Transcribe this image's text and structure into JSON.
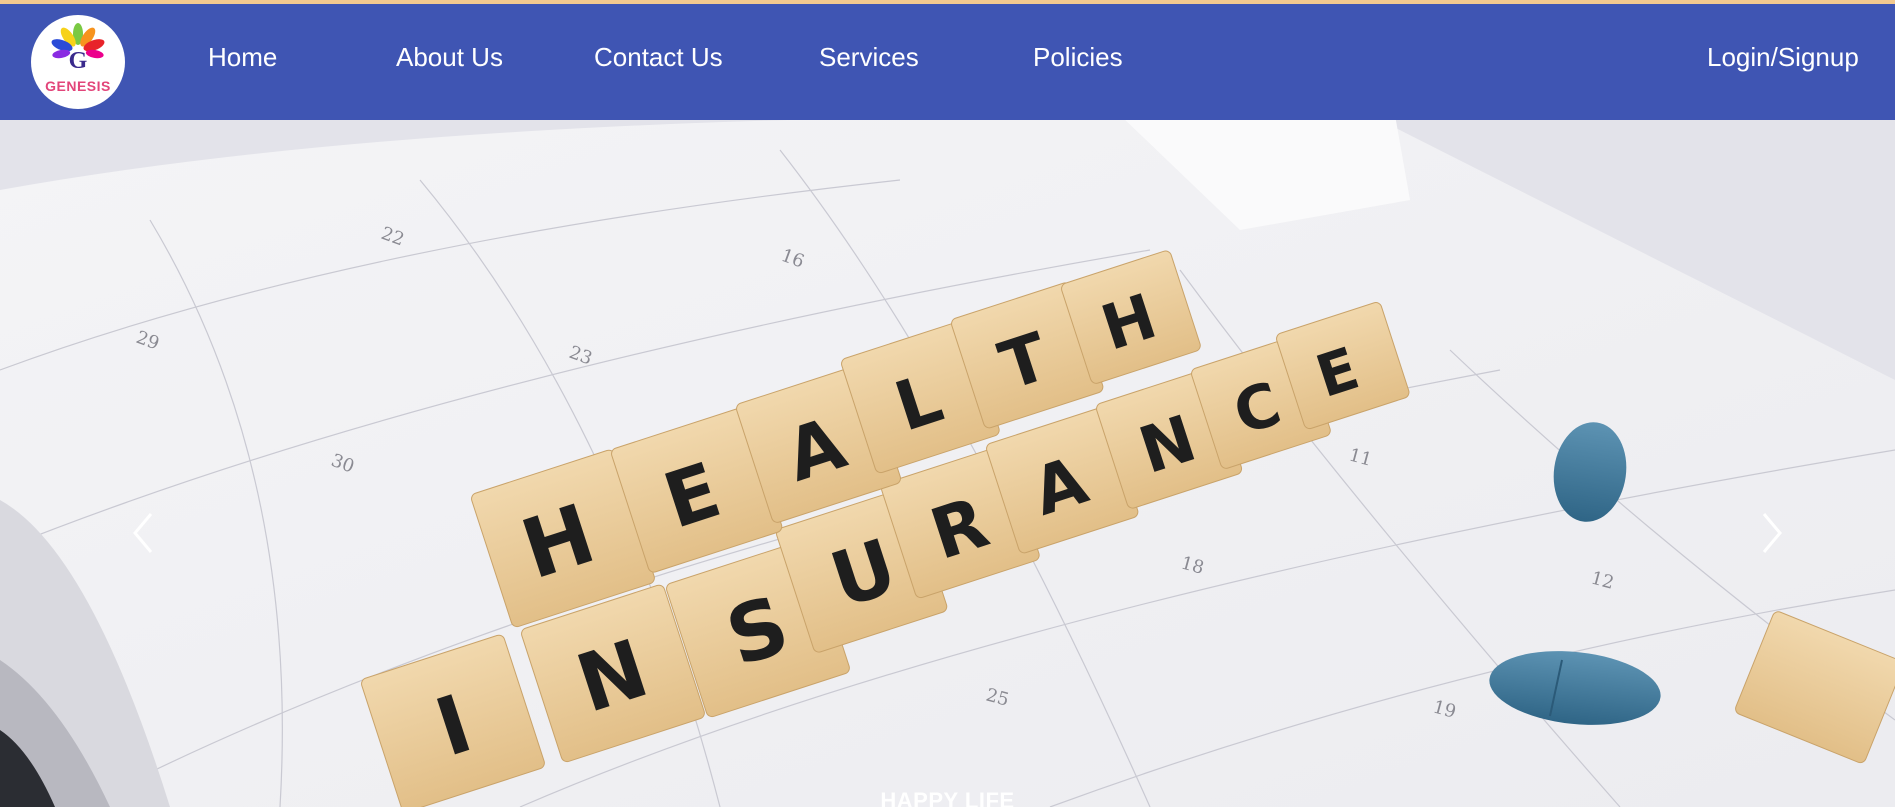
{
  "brand": {
    "logo_letter": "G",
    "logo_text": "GENESIS",
    "logo_icon": "lotus-g-logo"
  },
  "nav": {
    "items": [
      {
        "label": "Home"
      },
      {
        "label": "About Us"
      },
      {
        "label": "Contact Us"
      },
      {
        "label": "Services"
      },
      {
        "label": "Policies"
      }
    ],
    "login_label": "Login/Signup"
  },
  "hero": {
    "tiles_word_1": "HEALTH",
    "tiles_word_2": "INSURANCE",
    "caption": "HAPPY LIFE",
    "prev_icon": "chevron-left-icon",
    "next_icon": "chevron-right-icon"
  },
  "colors": {
    "nav_bg": "#3f55b3",
    "accent_strip": "#f2c98f",
    "logo_text": "#e2457a"
  }
}
